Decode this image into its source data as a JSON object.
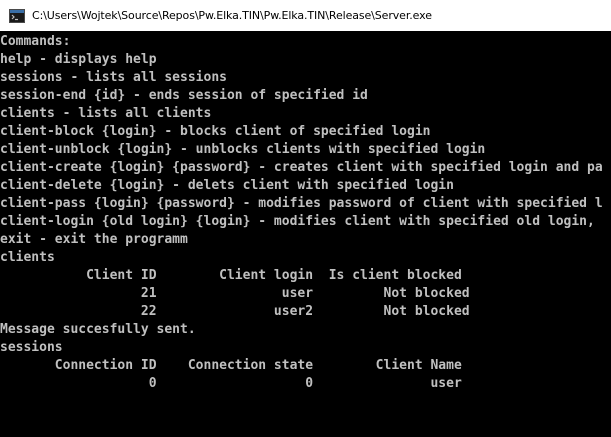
{
  "window": {
    "title": "C:\\Users\\Wojtek\\Source\\Repos\\Pw.Elka.TIN\\Pw.Elka.TIN\\Release\\Server.exe",
    "icon": "console-app-icon"
  },
  "colors": {
    "background": "#000000",
    "text": "#c0c0c0",
    "titlebar": "#ffffff"
  },
  "console": {
    "lines": [
      "Commands:",
      "help - displays help",
      "sessions - lists all sessions",
      "session-end {id} - ends session of specified id",
      "clients - lists all clients",
      "client-block {login} - blocks client of specified login",
      "client-unblock {login} - unblocks clients with specified login",
      "client-create {login} {password} - creates client with specified login and pa",
      "client-delete {login} - delets client with specified login",
      "client-pass {login} {password} - modifies password of client with specified l",
      "client-login {old login} {login} - modifies client with specified old login,",
      "exit - exit the programm",
      "clients",
      "           Client ID        Client login  Is client blocked",
      "                  21                user         Not blocked",
      "                  22               user2         Not blocked",
      "Message succesfully sent.",
      "sessions",
      "       Connection ID    Connection state        Client Name",
      "                   0                   0               user"
    ]
  }
}
